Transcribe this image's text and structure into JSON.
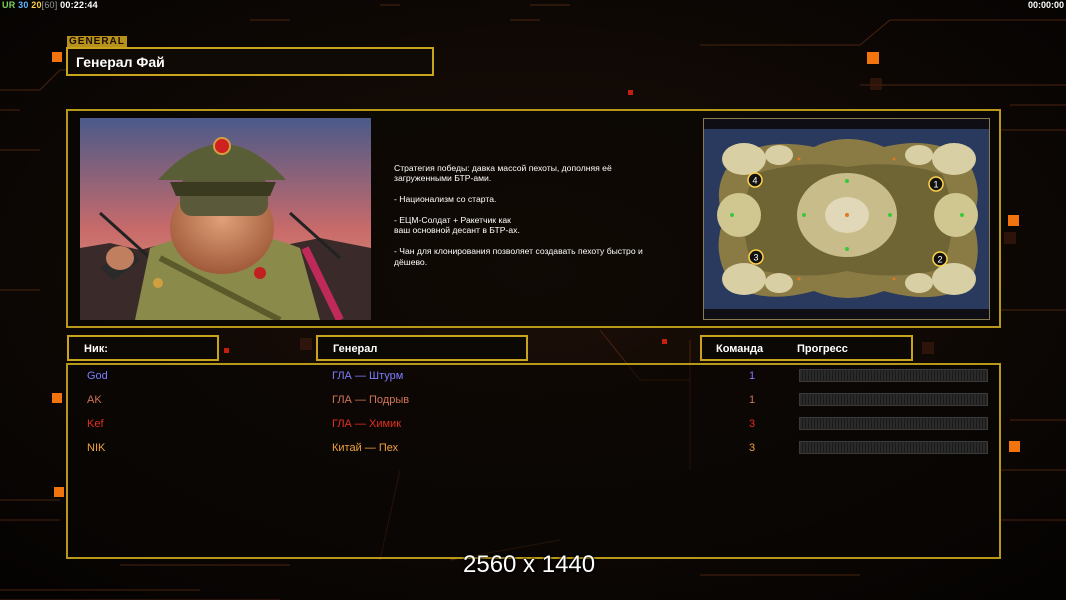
{
  "hud": {
    "ur_label": "UR",
    "stat_a": "30",
    "stat_b": "20",
    "fps": "[60]",
    "time_elapsed": "00:22:44",
    "clock_right": "00:00:00"
  },
  "header": {
    "tag": "GENERAL",
    "title": "Генерал Фай"
  },
  "strategy": {
    "paragraphs": [
      "Стратегия победы: давка массой пехоты, дополняя её\n загруженными БТР-ами.",
      "- Национализм со старта.",
      "- ЕЦМ-Солдат + Ракетчик как\nваш основной десант в БТР-ах.",
      "- Чан для клонирования позволяет создавать пехоту быстро и\n дёшево."
    ]
  },
  "minimap": {
    "start_positions": [
      "4",
      "1",
      "3",
      "2"
    ]
  },
  "columns": {
    "nick": "Ник:",
    "general": "Генерал",
    "team": "Команда",
    "progress": "Прогресс"
  },
  "players": [
    {
      "nick": "God",
      "general": "ГЛА — Штурм",
      "team": "1",
      "color": "#7d7dff",
      "progress": 0
    },
    {
      "nick": "AK",
      "general": "ГЛА — Подрыв",
      "team": "1",
      "color": "#d0745a",
      "progress": 0
    },
    {
      "nick": "Kef",
      "general": "ГЛА — Химик",
      "team": "3",
      "color": "#e03020",
      "progress": 0
    },
    {
      "nick": "NIK",
      "general": "Китай — Пех",
      "team": "3",
      "color": "#f0a040",
      "progress": 0
    }
  ],
  "watermark": "2560 x 1440",
  "colors": {
    "accent": "#c8a41c",
    "panel_border": "#b89818"
  }
}
